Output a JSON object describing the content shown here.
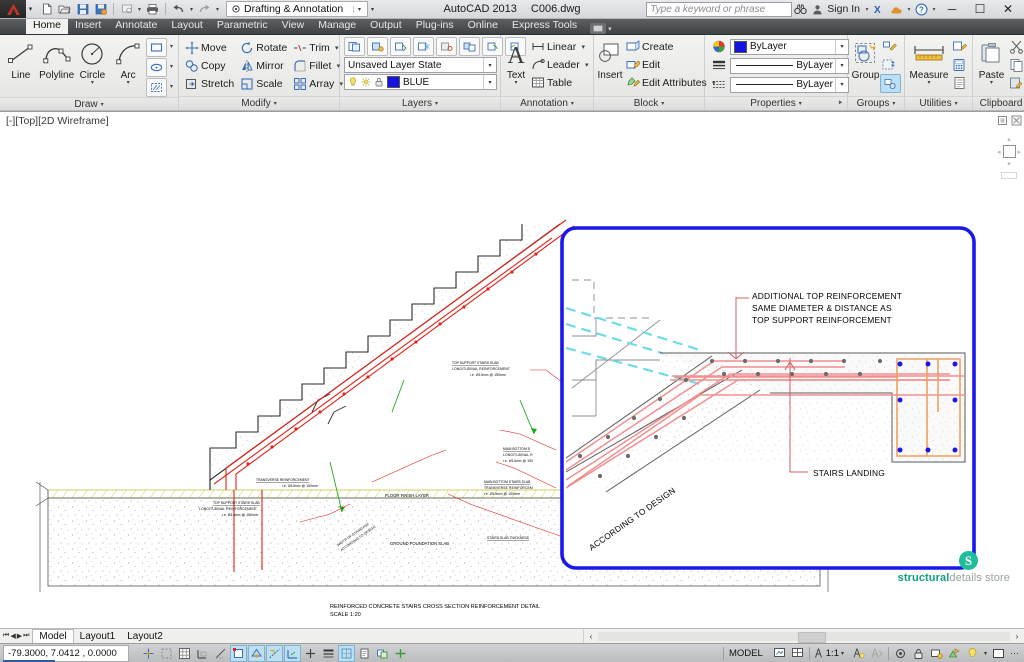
{
  "titlebar": {
    "app_menu_icon": "autocad-a-logo",
    "quick_access": [
      {
        "name": "new",
        "icon": "new-document-icon"
      },
      {
        "name": "open",
        "icon": "open-folder-icon"
      },
      {
        "name": "save",
        "icon": "floppy-save-icon"
      },
      {
        "name": "save-as",
        "icon": "save-as-icon"
      },
      {
        "name": "plot-preview",
        "icon": "plot-preview-icon"
      },
      {
        "name": "plot",
        "icon": "printer-icon"
      },
      {
        "name": "undo",
        "icon": "undo-arrow-icon"
      },
      {
        "name": "redo",
        "icon": "redo-arrow-icon"
      }
    ],
    "workspace": {
      "label": "Drafting & Annotation",
      "icon": "gear-icon"
    },
    "app_title": "AutoCAD 2013",
    "file_name": "C006.dwg",
    "search_placeholder": "Type a keyword or phrase",
    "sign_in_label": "Sign In",
    "window_buttons": {
      "minimize": "─",
      "maximize": "☐",
      "close": "✕"
    }
  },
  "ribbon_tabs": [
    {
      "label": "Home",
      "active": true
    },
    {
      "label": "Insert",
      "active": false
    },
    {
      "label": "Annotate",
      "active": false
    },
    {
      "label": "Layout",
      "active": false
    },
    {
      "label": "Parametric",
      "active": false
    },
    {
      "label": "View",
      "active": false
    },
    {
      "label": "Manage",
      "active": false
    },
    {
      "label": "Output",
      "active": false
    },
    {
      "label": "Plug-ins",
      "active": false
    },
    {
      "label": "Online",
      "active": false
    },
    {
      "label": "Express Tools",
      "active": false
    }
  ],
  "panels": {
    "draw": {
      "title": "Draw",
      "buttons": [
        {
          "label": "Line",
          "icon": "line-icon"
        },
        {
          "label": "Polyline",
          "icon": "polyline-icon"
        },
        {
          "label": "Circle",
          "icon": "circle-icon",
          "has_dropdown": true
        },
        {
          "label": "Arc",
          "icon": "arc-icon",
          "has_dropdown": true
        }
      ],
      "flyouts": [
        {
          "icon": "rectangle-icon"
        },
        {
          "icon": "ellipse-icon"
        },
        {
          "icon": "hatch-icon"
        }
      ]
    },
    "modify": {
      "title": "Modify",
      "items": [
        {
          "label": "Move",
          "icon": "move-icon"
        },
        {
          "label": "Rotate",
          "icon": "rotate-icon"
        },
        {
          "label": "Trim",
          "icon": "trim-icon",
          "has_dropdown": true
        },
        {
          "label": "Copy",
          "icon": "copy-icon"
        },
        {
          "label": "Mirror",
          "icon": "mirror-icon"
        },
        {
          "label": "Fillet",
          "icon": "fillet-icon",
          "has_dropdown": true
        },
        {
          "label": "Stretch",
          "icon": "stretch-icon"
        },
        {
          "label": "Scale",
          "icon": "scale-icon"
        },
        {
          "label": "Array",
          "icon": "array-icon",
          "has_dropdown": true
        }
      ],
      "side_icons": [
        {
          "icon": "edit-polyline-icon"
        },
        {
          "icon": "3d-solid-icon"
        },
        {
          "icon": "cloud-icon"
        }
      ]
    },
    "layers": {
      "title": "Layers",
      "tool_icons": [
        {
          "icon": "layer-properties-icon"
        },
        {
          "icon": "layer-isolate-icon"
        },
        {
          "icon": "layer-unisolate-icon"
        },
        {
          "icon": "layer-freeze-icon"
        },
        {
          "icon": "layer-off-icon"
        },
        {
          "icon": "layer-match-icon"
        },
        {
          "icon": "layer-previous-icon"
        },
        {
          "icon": "layer-walk-icon"
        }
      ],
      "layer_state": "Unsaved Layer State",
      "current_layer": "BLUE",
      "current_layer_color": "#1414e0",
      "toggle_icons": [
        {
          "icon": "lightbulb-icon"
        },
        {
          "icon": "sun-freeze-icon"
        },
        {
          "icon": "padlock-icon"
        }
      ]
    },
    "annotation": {
      "title": "Annotation",
      "big_button": {
        "label": "Text",
        "icon": "text-a-icon",
        "has_dropdown": true
      },
      "items": [
        {
          "label": "Linear",
          "icon": "linear-dimension-icon",
          "has_dropdown": true
        },
        {
          "label": "Leader",
          "icon": "leader-icon",
          "has_dropdown": true
        },
        {
          "label": "Table",
          "icon": "table-icon"
        }
      ]
    },
    "block": {
      "title": "Block",
      "big_button": {
        "label": "Insert",
        "icon": "insert-block-icon"
      },
      "items": [
        {
          "label": "Create",
          "icon": "create-block-icon"
        },
        {
          "label": "Edit",
          "icon": "edit-block-icon"
        },
        {
          "label": "Edit Attributes",
          "icon": "edit-attributes-icon",
          "has_dropdown": true
        }
      ]
    },
    "properties": {
      "title": "Properties",
      "rows": [
        {
          "icon": "color-wheel-icon",
          "value": "ByLayer",
          "swatch": "#1414e0"
        },
        {
          "icon": "linewidth-icon",
          "value": "ByLayer",
          "swatch": null
        },
        {
          "icon": "linetype-icon",
          "value": "ByLayer",
          "swatch": null
        }
      ]
    },
    "groups": {
      "title": "Groups",
      "big_button": {
        "label": "Group",
        "icon": "group-icon"
      },
      "side_icons": [
        {
          "icon": "ungroup-icon"
        },
        {
          "icon": "group-edit-icon"
        },
        {
          "icon": "group-selection-on-icon"
        }
      ]
    },
    "utilities": {
      "title": "Utilities",
      "big_button": {
        "label": "Measure",
        "icon": "measure-ruler-icon",
        "has_dropdown": true
      },
      "side_icons": [
        {
          "icon": "quick-select-icon"
        },
        {
          "icon": "quick-calc-icon"
        },
        {
          "icon": "list-icon"
        }
      ]
    },
    "clipboard": {
      "title": "Clipboard",
      "big_button": {
        "label": "Paste",
        "icon": "paste-icon",
        "has_dropdown": true
      },
      "side_icons": [
        {
          "icon": "cut-scissors-icon"
        },
        {
          "icon": "copy-clip-icon"
        },
        {
          "icon": "paste-special-icon"
        }
      ]
    }
  },
  "viewport": {
    "label": "[-][Top][2D Wireframe]",
    "navigation_icons": [
      "viewcube-icon",
      "full-navigation-wheel-icon",
      "pan-icon",
      "zoom-icon",
      "orbit-icon"
    ]
  },
  "drawing": {
    "detail_box_color": "#1a18e8",
    "callouts": [
      {
        "name": "additional-top-reinforcement",
        "lines": [
          "ADDITIONAL TOP REINFORCEMENT",
          "SAME DIAMETER & DISTANCE AS",
          "TOP SUPPORT REINFORCEMENT"
        ]
      },
      {
        "name": "stairs-landing",
        "lines": [
          "STAIRS LANDING"
        ]
      },
      {
        "name": "according-to-design",
        "lines": [
          "ACCORDING TO DESIGN"
        ]
      }
    ],
    "small_labels": [
      {
        "name": "top-support-upper",
        "lines": [
          "TOP SUPPORT STAIRS SLAB",
          "LONGITUDINAL REINFORCEMENT",
          "i.e. Ø14mm @ 150mm"
        ]
      },
      {
        "name": "transverse-reinforcement",
        "lines": [
          "TRANSVERSE REINFORCEMENT",
          "i.e. Ø10mm @ 150mm"
        ]
      },
      {
        "name": "top-support-lower",
        "lines": [
          "TOP SUPPORT STAIRS SLAB",
          "LONGITUDINAL REINFORCEMENT",
          "i.e. Ø14mm @ 150mm"
        ]
      },
      {
        "name": "main-bottom-longitudinal",
        "lines": [
          "MAIN BOTTOM S",
          "LONGITUDINAL R",
          "i.e. Ø14mm @ 150"
        ]
      },
      {
        "name": "main-bottom-transverse",
        "lines": [
          "MAIN BOTTOM STAIRS SLAB",
          "TRANSVERSE REINFORCEM",
          "i.e. Ø10mm @ 150mm"
        ]
      },
      {
        "name": "stairs-slab-thickness",
        "lines": [
          "STAIRS SLAB THICKNESS"
        ]
      },
      {
        "name": "staircase-width",
        "lines": [
          "WIDTH OF STAIRCASE",
          "ACCORDING TO DESIGN"
        ]
      }
    ],
    "red_labels": [
      {
        "name": "floor-finish-layer",
        "text": "FLOOR FINISH LAYER"
      },
      {
        "name": "ground-foundation-slab",
        "text": "GROUND FOUNDATION SLAB"
      }
    ],
    "title_block": {
      "line1": "REINFORCED CONCRETE STAIRS CROSS SECTION REINFORCEMENT DETAIL",
      "line2": "SCALE 1:20"
    },
    "logo": {
      "mark": "S",
      "bold": "structural",
      "light": "details store",
      "color": "#0f9f84"
    }
  },
  "layout_tabs": {
    "nav": [
      "⏮",
      "◀",
      "▶",
      "⏭"
    ],
    "tabs": [
      {
        "label": "Model",
        "active": true
      },
      {
        "label": "Layout1",
        "active": false
      },
      {
        "label": "Layout2",
        "active": false
      }
    ]
  },
  "statusbar": {
    "coordinates": "-79.3000, 7.0412 , 0.0000",
    "left_toggles": [
      {
        "name": "infer-constraints",
        "icon": "infer-constraints-icon",
        "on": false
      },
      {
        "name": "snap-mode",
        "icon": "snap-mode-icon",
        "on": false
      },
      {
        "name": "grid-display",
        "icon": "grid-display-icon",
        "on": false
      },
      {
        "name": "ortho-mode",
        "icon": "ortho-mode-icon",
        "on": false
      },
      {
        "name": "polar-tracking",
        "icon": "polar-tracking-icon",
        "on": false
      },
      {
        "name": "object-snap",
        "icon": "object-snap-icon",
        "on": true
      },
      {
        "name": "3d-object-snap",
        "icon": "3d-object-snap-icon",
        "on": true
      },
      {
        "name": "object-snap-tracking",
        "icon": "object-snap-tracking-icon",
        "on": true
      },
      {
        "name": "dynamic-ucs",
        "icon": "dynamic-ucs-icon",
        "on": true
      },
      {
        "name": "dynamic-input",
        "icon": "dynamic-input-icon",
        "on": false
      },
      {
        "name": "lineweight",
        "icon": "lineweight-icon",
        "on": false
      },
      {
        "name": "transparency",
        "icon": "transparency-icon",
        "on": true
      },
      {
        "name": "quick-properties",
        "icon": "quick-properties-icon",
        "on": false
      },
      {
        "name": "selection-cycling",
        "icon": "selection-cycling-icon",
        "on": false
      },
      {
        "name": "annotation-monitor",
        "icon": "annotation-monitor-icon",
        "on": false
      }
    ],
    "space_label": "MODEL",
    "annotation_scale": "1:1",
    "right_icons": [
      {
        "name": "clean-screen",
        "icon": "clean-screen-icon"
      },
      {
        "name": "viewport-config",
        "icon": "viewport-config-icon"
      },
      {
        "name": "annotation-visibility",
        "icon": "annotation-visibility-icon"
      },
      {
        "name": "autoscale",
        "icon": "autoscale-icon"
      },
      {
        "name": "workspace-switching",
        "icon": "gear-icon"
      },
      {
        "name": "toolbar-lock",
        "icon": "padlock-icon"
      },
      {
        "name": "hardware-acceleration",
        "icon": "hardware-acceleration-icon"
      },
      {
        "name": "isolate-objects",
        "icon": "isolate-objects-icon"
      },
      {
        "name": "status-bar-menu",
        "icon": "chevron-down-icon"
      }
    ]
  }
}
